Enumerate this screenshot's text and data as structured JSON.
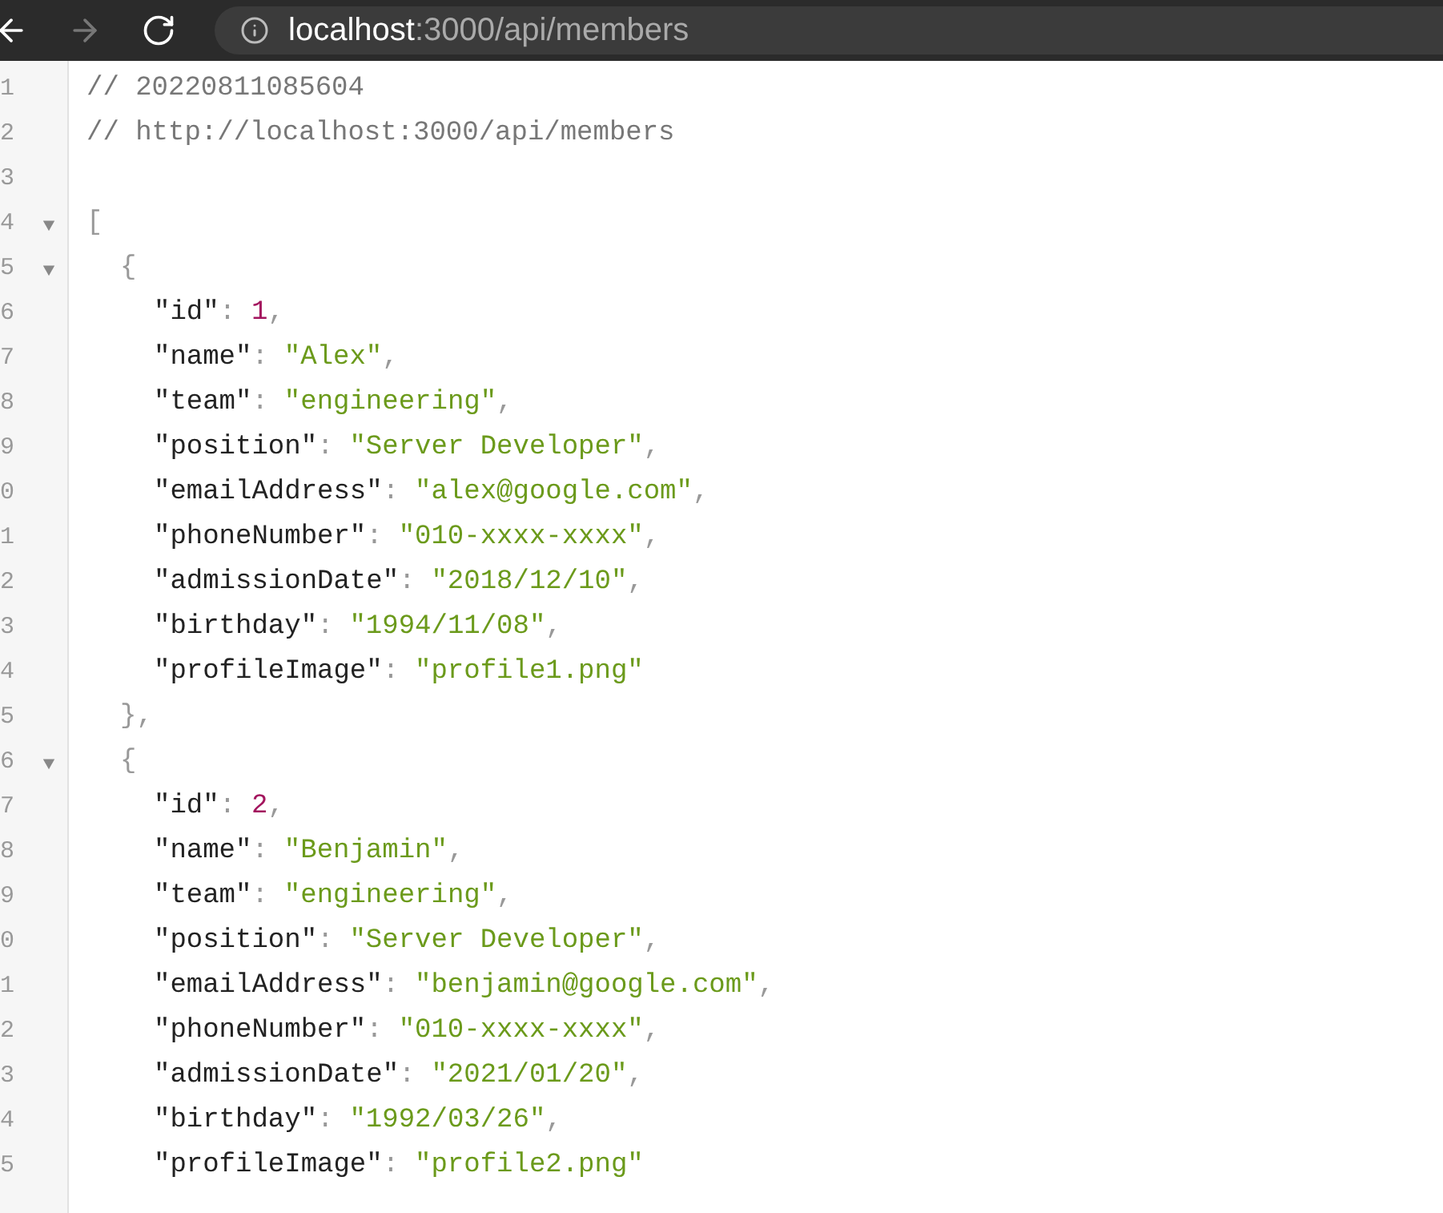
{
  "toolbar": {
    "nav": [
      {
        "kind": "back",
        "disabled": false
      },
      {
        "kind": "forward",
        "disabled": true
      },
      {
        "kind": "reload",
        "disabled": false
      }
    ],
    "address": {
      "host": "localhost",
      "path": ":3000/api/members"
    }
  },
  "viewer": {
    "comments": [
      {
        "number": "1",
        "text": "// 20220811085604"
      },
      {
        "number": "2",
        "text": "// http://localhost:3000/api/members"
      },
      {
        "number": "3"
      }
    ],
    "root": {
      "number": "4",
      "expanded": true,
      "open": "[",
      "children": [
        {
          "number": "5",
          "expanded": true,
          "open": "{",
          "close": {
            "number": "5",
            "text": "},"
          },
          "properties": [
            {
              "number": "6",
              "key": "\"id\"",
              "colon": ":",
              "value": "1",
              "kind": "number",
              "trail": ","
            },
            {
              "number": "7",
              "key": "\"name\"",
              "colon": ":",
              "value": "\"Alex\"",
              "kind": "string",
              "trail": ","
            },
            {
              "number": "8",
              "key": "\"team\"",
              "colon": ":",
              "value": "\"engineering\"",
              "kind": "string",
              "trail": ","
            },
            {
              "number": "9",
              "key": "\"position\"",
              "colon": ":",
              "value": "\"Server Developer\"",
              "kind": "string",
              "trail": ","
            },
            {
              "number": "0",
              "key": "\"emailAddress\"",
              "colon": ":",
              "value": "\"alex@google.com\"",
              "kind": "string",
              "trail": ","
            },
            {
              "number": "1",
              "key": "\"phoneNumber\"",
              "colon": ":",
              "value": "\"010-xxxx-xxxx\"",
              "kind": "string",
              "trail": ","
            },
            {
              "number": "2",
              "key": "\"admissionDate\"",
              "colon": ":",
              "value": "\"2018/12/10\"",
              "kind": "string",
              "trail": ","
            },
            {
              "number": "3",
              "key": "\"birthday\"",
              "colon": ":",
              "value": "\"1994/11/08\"",
              "kind": "string",
              "trail": ","
            },
            {
              "number": "4",
              "key": "\"profileImage\"",
              "colon": ":",
              "value": "\"profile1.png\"",
              "kind": "string"
            }
          ]
        },
        {
          "number": "6",
          "expanded": true,
          "open": "{",
          "properties": [
            {
              "number": "7",
              "key": "\"id\"",
              "colon": ":",
              "value": "2",
              "kind": "number",
              "trail": ","
            },
            {
              "number": "8",
              "key": "\"name\"",
              "colon": ":",
              "value": "\"Benjamin\"",
              "kind": "string",
              "trail": ","
            },
            {
              "number": "9",
              "key": "\"team\"",
              "colon": ":",
              "value": "\"engineering\"",
              "kind": "string",
              "trail": ","
            },
            {
              "number": "0",
              "key": "\"position\"",
              "colon": ":",
              "value": "\"Server Developer\"",
              "kind": "string",
              "trail": ","
            },
            {
              "number": "1",
              "key": "\"emailAddress\"",
              "colon": ":",
              "value": "\"benjamin@google.com\"",
              "kind": "string",
              "trail": ","
            },
            {
              "number": "2",
              "key": "\"phoneNumber\"",
              "colon": ":",
              "value": "\"010-xxxx-xxxx\"",
              "kind": "string",
              "trail": ","
            },
            {
              "number": "3",
              "key": "\"admissionDate\"",
              "colon": ":",
              "value": "\"2021/01/20\"",
              "kind": "string",
              "trail": ","
            },
            {
              "number": "4",
              "key": "\"birthday\"",
              "colon": ":",
              "value": "\"1992/03/26\"",
              "kind": "string",
              "trail": ","
            },
            {
              "number": "5",
              "key": "\"profileImage\"",
              "colon": ":",
              "value": "\"profile2.png\"",
              "kind": "string"
            }
          ]
        }
      ]
    }
  }
}
